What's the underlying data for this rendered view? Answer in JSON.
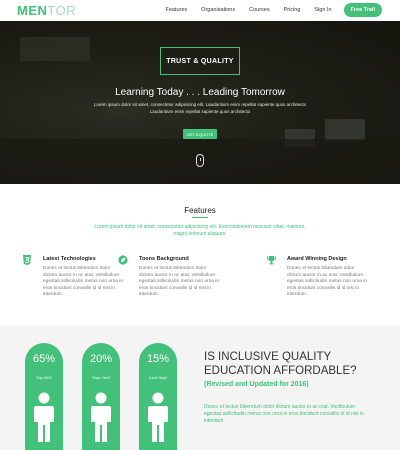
{
  "nav": {
    "logo_a": "MEN",
    "logo_b": "TOR",
    "items": [
      "Features",
      "Organisations",
      "Courses",
      "Pricing",
      "Sign In"
    ],
    "cta": "Free Trail"
  },
  "hero": {
    "badge": "TRUST & QUALITY",
    "title": "Learning Today . . . Leading Tomorrow",
    "sub1": "Lorem ipsum dolor sit amet, consectetur adipisicing elit. Laudantium enim repellat sapiente quos architecto",
    "sub2": "Laudantium enim repellat sapiente quos architecto",
    "button": "GET A QUOTE"
  },
  "features": {
    "title": "Features",
    "intro": "Lorem ipsum dolor sit amet, consectetur adipisicing elit. Exercitationem nesciunt vitae, maiores, magni dolorum aliquam.",
    "items": [
      {
        "icon": "html5-icon",
        "title": "Latest Technologies",
        "text": "Donec et lectus bibendum dolor dictum auctor in ac erat. Vestibulum egestas sollicitudin metus non urna in eros tincidunt convallis id id nisi in interdum."
      },
      {
        "icon": "leaf-icon",
        "title": "Toons Background",
        "text": "Donec et lectus bibendum dolor dictum auctor in ac erat. Vestibulum egestas sollicitudin metus non urna in eros tincidunt convallis id id nisi in interdum."
      },
      {
        "icon": "trophy-icon",
        "title": "Award Winning Design",
        "text": "Donec et lectus bibendum dolor dictum auctor in ac erat. Vestibulum egestas sollicitudin metus non urna in eros tincidunt convallis id id nisi in interdum."
      }
    ]
  },
  "stats": [
    {
      "value": "65%",
      "label": "Say NO!!"
    },
    {
      "value": "20%",
      "label": "Says Yes!!"
    },
    {
      "value": "15%",
      "label": "Can't Say!!"
    }
  ],
  "quality": {
    "title_line1": "IS INCLUSIVE QUALITY",
    "title_line2": "EDUCATION AFFORDABLE?",
    "subtitle": "(Revised and Updated for 2016)",
    "text": "Donec et lectus bibendum dolor dictum auctor in ac erat. Vestibulum egestas sollicitudin metus non urna in eros tincidunt convallis id id nisi in interdum."
  },
  "colors": {
    "accent": "#43c07a"
  }
}
